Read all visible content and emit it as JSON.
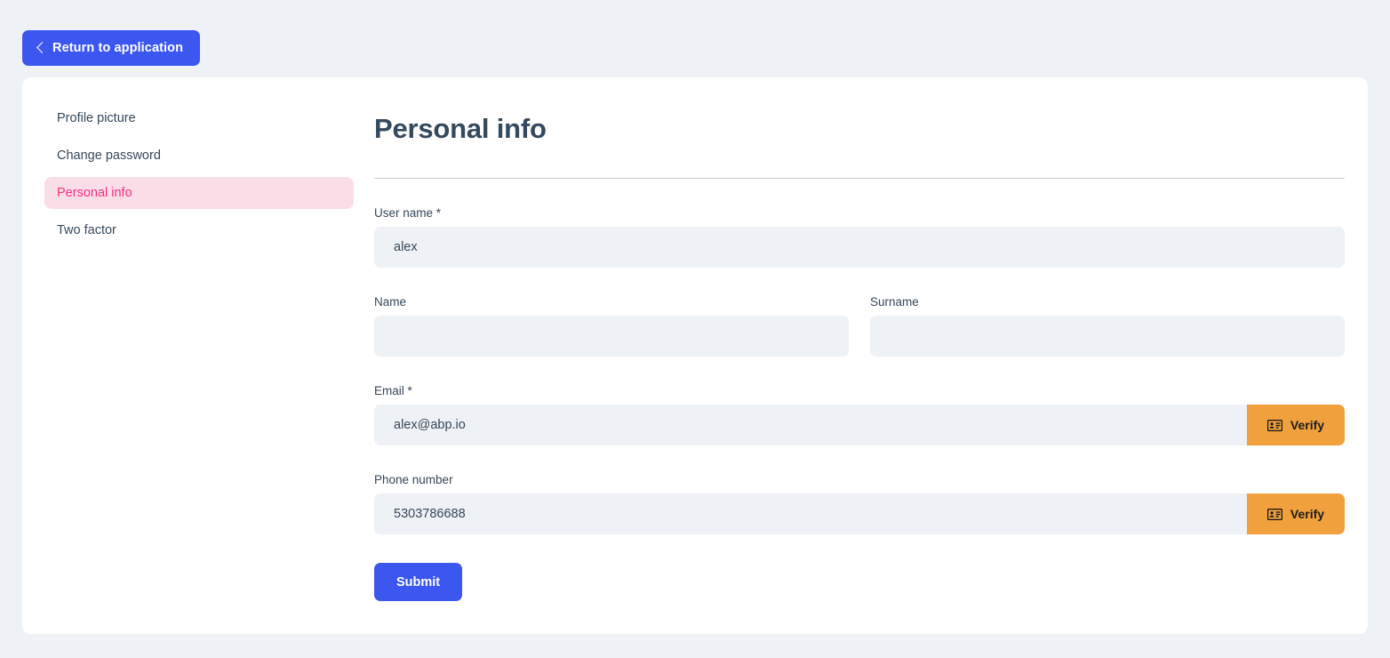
{
  "top_bar": {
    "return_button": {
      "label": "Return to application",
      "icon": "chevron-left-icon",
      "bg_color": "#3c57f0",
      "text_color": "#ffffff"
    }
  },
  "sidebar": {
    "items": [
      {
        "label": "Profile picture",
        "active": false
      },
      {
        "label": "Change password",
        "active": false
      },
      {
        "label": "Personal info",
        "active": true
      },
      {
        "label": "Two factor",
        "active": false
      }
    ],
    "active_bg_color": "#fbdde8",
    "active_text_color": "#f5327f",
    "text_color": "#37475a"
  },
  "main": {
    "title": "Personal info",
    "fields": {
      "username": {
        "label": "User name *",
        "value": "alex",
        "placeholder": ""
      },
      "name": {
        "label": "Name",
        "value": "",
        "placeholder": ""
      },
      "surname": {
        "label": "Surname",
        "value": "",
        "placeholder": ""
      },
      "email": {
        "label": "Email *",
        "value": "alex@abp.io",
        "placeholder": "",
        "verify_label": "Verify",
        "verify_icon": "id-card-icon"
      },
      "phone": {
        "label": "Phone number",
        "value": "5303786688",
        "placeholder": "",
        "verify_label": "Verify",
        "verify_icon": "id-card-icon"
      }
    },
    "submit_label": "Submit",
    "colors": {
      "page_bg": "#eef1f5",
      "card_bg": "#ffffff",
      "input_bg": "#eef1f5",
      "verify_bg": "#f0a03c",
      "primary": "#3c57f0",
      "heading": "#34495e"
    }
  }
}
